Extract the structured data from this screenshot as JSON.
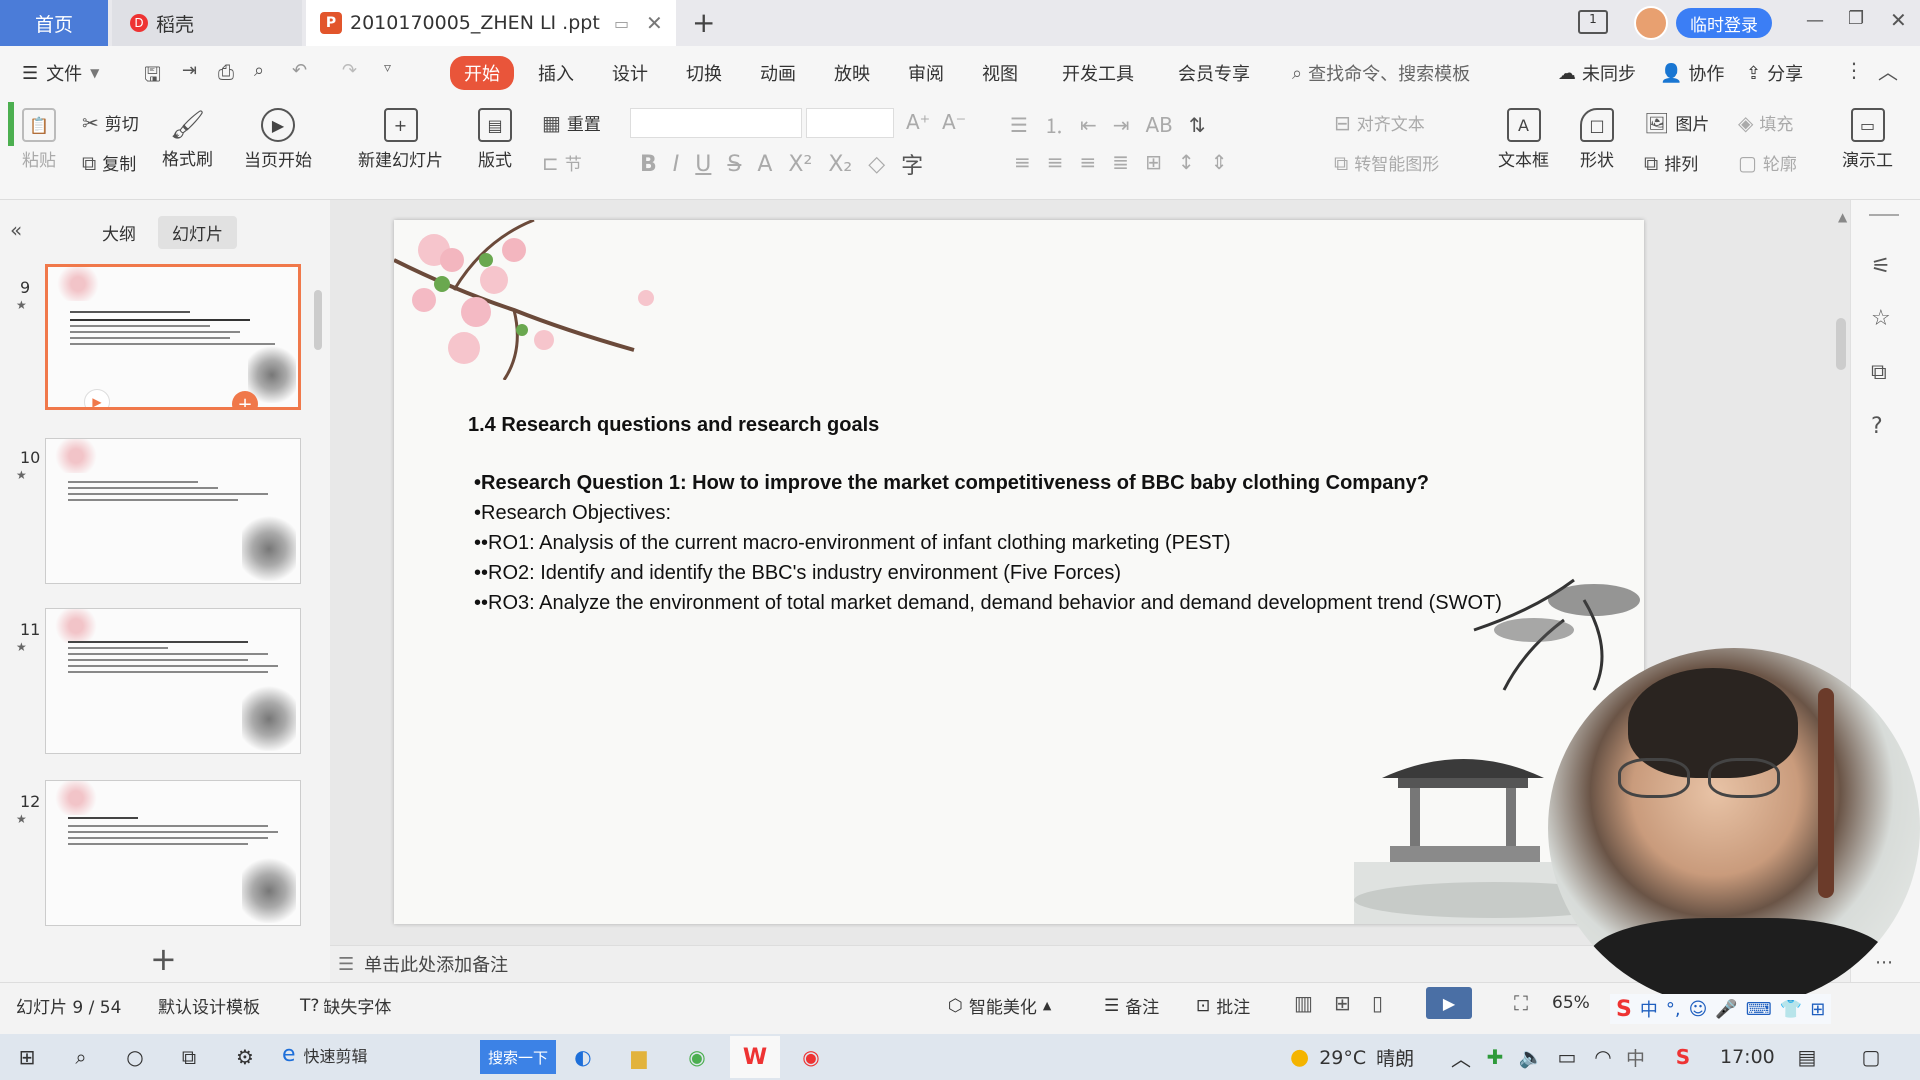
{
  "titlebar": {
    "tab_home": "首页",
    "tab_daoke": "稻壳",
    "tab_doc": "2010170005_ZHEN LI .ppt",
    "login_button": "临时登录",
    "new_tab": "+"
  },
  "menubar": {
    "file": "文件",
    "items": [
      "开始",
      "插入",
      "设计",
      "切换",
      "动画",
      "放映",
      "审阅",
      "视图",
      "开发工具",
      "会员专享"
    ],
    "search_placeholder": "查找命令、搜索模板",
    "sync": "未同步",
    "collab": "协作",
    "share": "分享"
  },
  "ribbon": {
    "paste": "粘贴",
    "cut": "剪切",
    "copy": "复制",
    "format_painter": "格式刷",
    "play_current": "当页开始",
    "new_slide": "新建幻灯片",
    "layout": "版式",
    "reset": "重置",
    "section": "节",
    "align_text": "对齐文本",
    "smart_shape": "转智能图形",
    "textbox": "文本框",
    "shape": "形状",
    "picture": "图片",
    "arrange": "排列",
    "fill": "填充",
    "outline": "轮廓",
    "presentation_tool": "演示工"
  },
  "left_panel": {
    "tab_outline": "大纲",
    "tab_slides": "幻灯片",
    "slide_numbers": [
      "9",
      "10",
      "11",
      "12"
    ],
    "add": "+"
  },
  "slide": {
    "heading": "1.4 Research questions and research goals",
    "lines": [
      "•Research Question 1: How to improve the market competitiveness of BBC baby clothing Company?",
      "•Research Objectives:",
      "••RO1: Analysis of the current macro-environment of infant clothing marketing (PEST)",
      "••RO2: Identify and identify the BBC's industry environment (Five Forces)",
      "••RO3: Analyze the environment of total market demand, demand behavior and demand development trend (SWOT)"
    ]
  },
  "notes": {
    "placeholder": "单击此处添加备注"
  },
  "statusbar": {
    "slide_counter": "幻灯片 9 / 54",
    "template": "默认设计模板",
    "missing_font": "缺失字体",
    "smart_beautify": "智能美化",
    "notes": "备注",
    "comment": "批注",
    "zoom": "65%"
  },
  "taskbar": {
    "app_label": "快速剪辑",
    "search_button": "搜索一下",
    "weather_temp": "29°C",
    "weather_desc": "晴朗",
    "ime": "中",
    "time": "17:00"
  },
  "colors": {
    "accent": "#e9553a",
    "home_tab": "#4b7cd8",
    "login_btn": "#3b7ef5",
    "selection": "#f0784a"
  }
}
